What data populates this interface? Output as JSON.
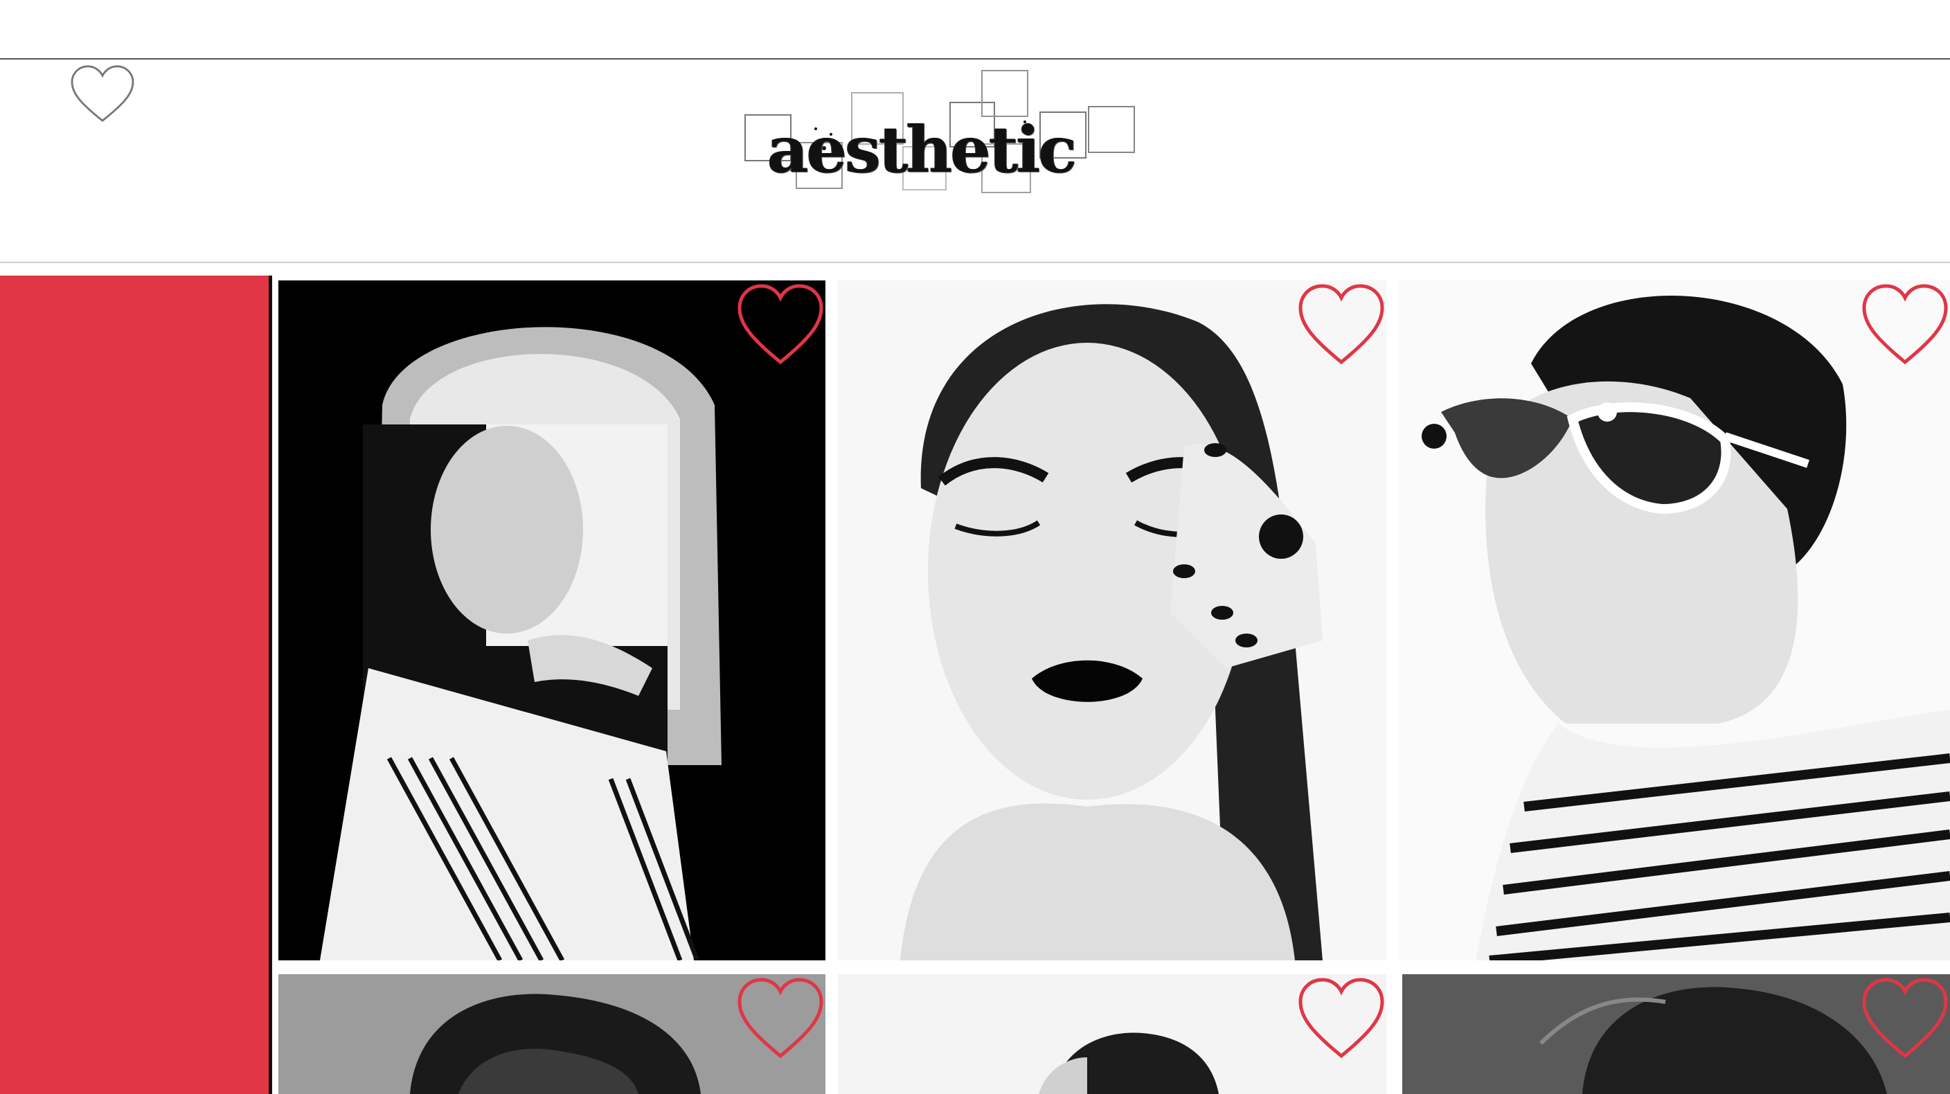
{
  "header": {
    "logo_text": "aesthetic"
  },
  "colors": {
    "accent": "#e03646",
    "heart_outline_top": "#777777",
    "heart_outline_card": "#e03646"
  },
  "icons": {
    "favorites": "heart-outline-icon",
    "card_like": "heart-outline-icon"
  },
  "gallery": {
    "cards": [
      {
        "row": 1,
        "col": 1,
        "content": "portrait"
      },
      {
        "row": 1,
        "col": 2,
        "content": "portrait"
      },
      {
        "row": 1,
        "col": 3,
        "content": "portrait"
      },
      {
        "row": 2,
        "col": 1,
        "content": "portrait"
      },
      {
        "row": 2,
        "col": 2,
        "content": "portrait"
      },
      {
        "row": 2,
        "col": 3,
        "content": "portrait"
      }
    ]
  }
}
